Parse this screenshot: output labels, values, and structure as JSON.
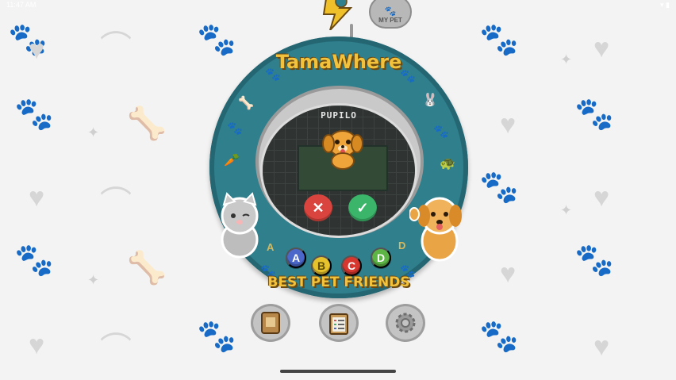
{
  "status_bar": {
    "time": "11:47 AM"
  },
  "keychain": {
    "tag_label": "MY PET"
  },
  "device": {
    "brand_title": "TamaWhere",
    "bottom_title": "BEST PET FRIENDS",
    "letters": {
      "left": "A",
      "right": "D"
    }
  },
  "screen": {
    "pet_name": "PUPILO",
    "cancel_symbol": "✕",
    "confirm_symbol": "✓"
  },
  "buttons": {
    "a": "A",
    "b": "B",
    "c": "C",
    "d": "D"
  },
  "bottom_nav": [
    {
      "name": "journal",
      "icon": "journal-book-icon"
    },
    {
      "name": "tasks",
      "icon": "clipboard-list-icon"
    },
    {
      "name": "settings",
      "icon": "gear-icon"
    }
  ],
  "colors": {
    "device_teal": "#2f7f8d",
    "brand_gold": "#f2c23c",
    "cancel_red": "#d9443e",
    "confirm_green": "#3bb56a",
    "button_a": "#4a67c9",
    "button_b": "#e6c22c",
    "button_c": "#d6372f",
    "button_d": "#5db545"
  }
}
